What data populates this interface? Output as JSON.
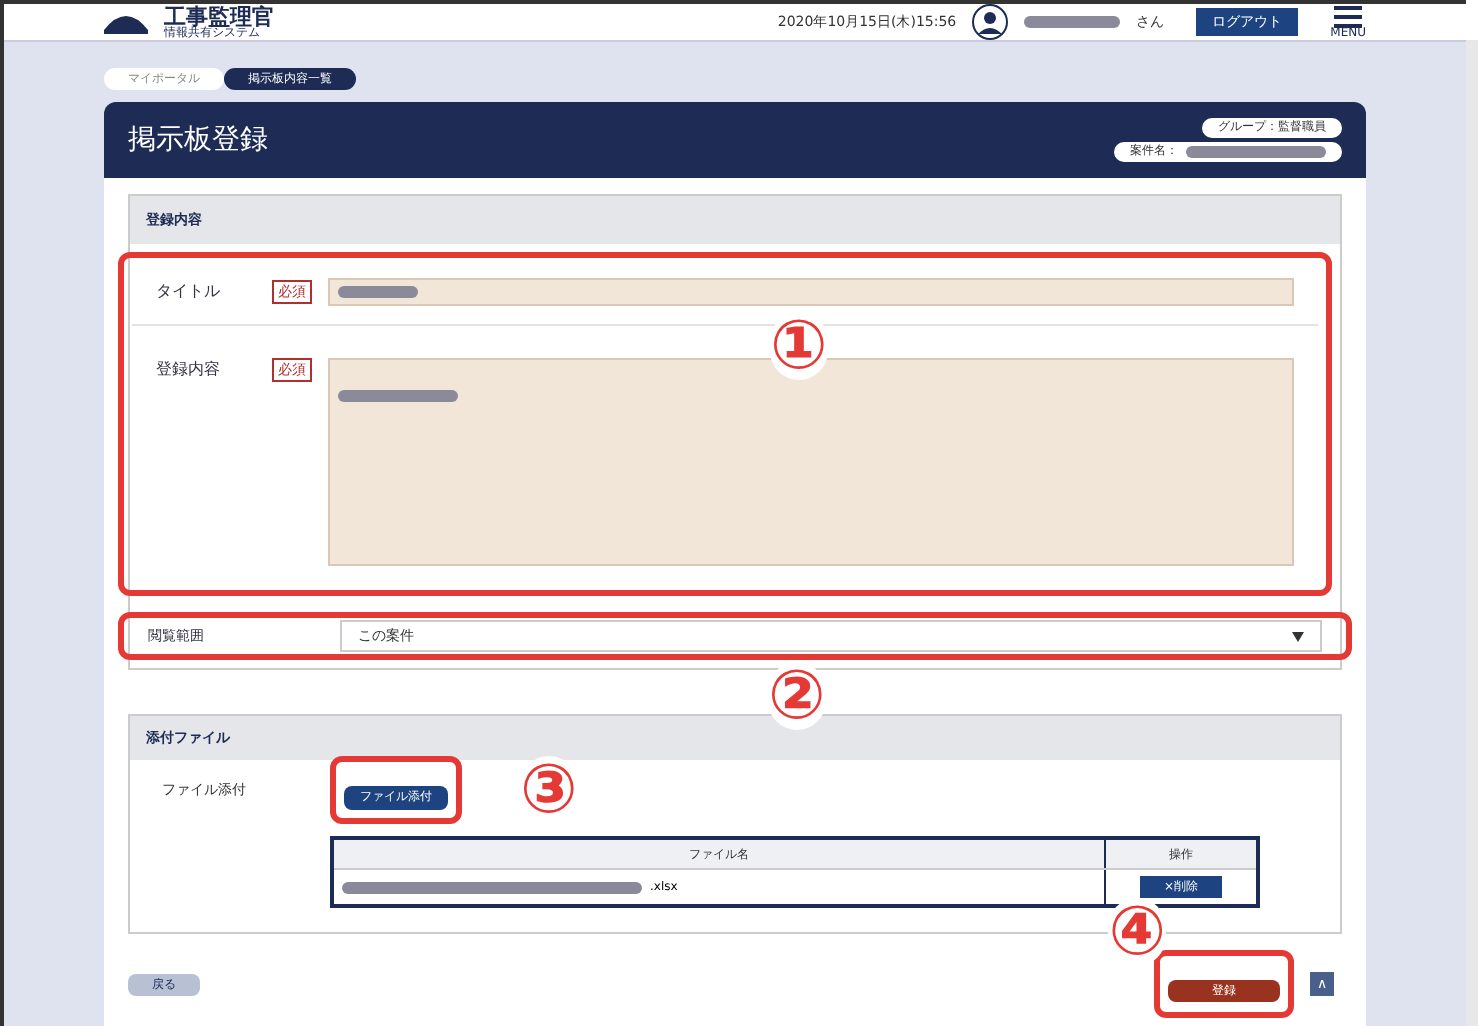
{
  "header": {
    "logo_title": "工事監理官",
    "logo_subtitle": "情報共有システム",
    "datetime": "2020年10月15日(木)15:56",
    "user_suffix": "さん",
    "logout": "ログアウト",
    "menu": "MENU"
  },
  "breadcrumb": [
    {
      "label": "マイポータル",
      "selected": false
    },
    {
      "label": "掲示板内容一覧",
      "selected": true
    }
  ],
  "page": {
    "title": "掲示板登録",
    "group": "グループ：監督職員",
    "project_label": "案件名："
  },
  "form": {
    "section": "登録内容",
    "fields": [
      {
        "kind": "text",
        "label": "タイトル",
        "required": "必須"
      },
      {
        "kind": "textarea",
        "label": "登録内容",
        "required": "必須"
      },
      {
        "kind": "select",
        "label": "閲覧範囲",
        "value": "この案件"
      }
    ]
  },
  "attachments": {
    "section": "添付ファイル",
    "label": "ファイル添付",
    "button": "ファイル添付",
    "columns": [
      "ファイル名",
      "操作"
    ],
    "rows": [
      {
        "file_ext": ".xlsx",
        "action": "×削除"
      }
    ]
  },
  "footer": {
    "back": "戻る",
    "submit": "登録",
    "top": "∧"
  },
  "callouts": [
    "①",
    "②",
    "③",
    "④"
  ]
}
